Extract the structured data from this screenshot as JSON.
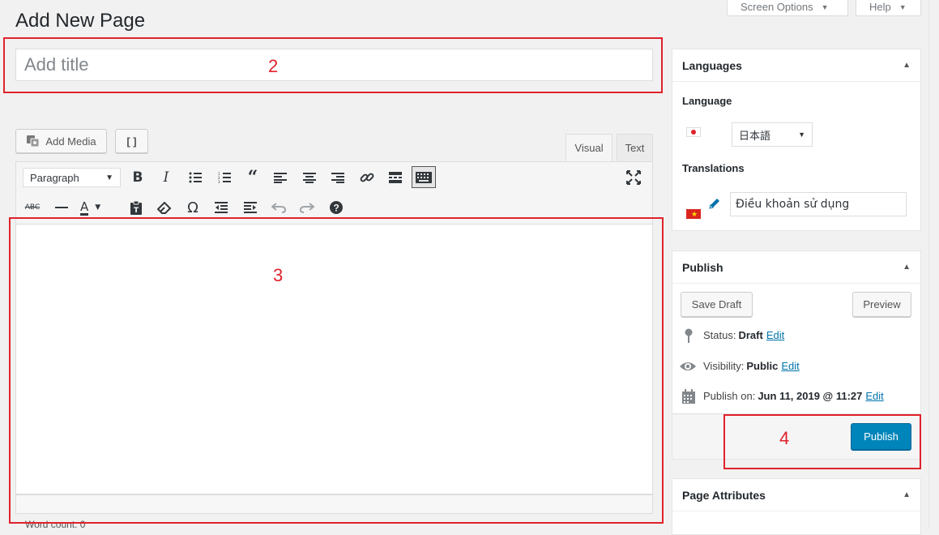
{
  "page": {
    "heading": "Add New Page"
  },
  "header_tabs": {
    "screen_options": "Screen Options",
    "help": "Help"
  },
  "title_field": {
    "placeholder": "Add title",
    "value": ""
  },
  "annotations": {
    "n2": "2",
    "n3": "3",
    "n4": "4",
    "color": "#e0222c"
  },
  "editor": {
    "add_media": "Add Media",
    "fullscreen_glyph": "[ ]",
    "tab_visual": "Visual",
    "tab_text": "Text",
    "format_select": "Paragraph",
    "toolbar_row1": [
      "bold-icon",
      "italic-icon",
      "bullet-list-icon",
      "numbered-list-icon",
      "blockquote-icon",
      "align-left-icon",
      "align-center-icon",
      "align-right-icon",
      "link-icon",
      "read-more-icon",
      "toolbar-toggle-icon"
    ],
    "toolbar_row2": [
      "strikethrough-icon",
      "horizontal-line-icon",
      "text-color-icon",
      "paste-text-icon",
      "clear-formatting-icon",
      "special-char-icon",
      "outdent-icon",
      "indent-icon",
      "undo-icon",
      "redo-icon",
      "help-icon"
    ],
    "word_count": "Word count: 0"
  },
  "languages_box": {
    "title": "Languages",
    "language_label": "Language",
    "language_value": "日本語",
    "translations_label": "Translations",
    "translation_value": "Điều khoản sử dụng"
  },
  "publish_box": {
    "title": "Publish",
    "save_draft": "Save Draft",
    "preview": "Preview",
    "status_label": "Status:",
    "status_value": "Draft",
    "visibility_label": "Visibility:",
    "visibility_value": "Public",
    "publish_on_label": "Publish on:",
    "publish_on_value": "Jun 11, 2019 @ 11:27",
    "edit_link": "Edit",
    "publish_button": "Publish"
  },
  "page_attributes_box": {
    "title": "Page Attributes"
  },
  "colors": {
    "primary_button": "#0085ba",
    "link": "#0073aa",
    "annotation": "#e0222c"
  }
}
